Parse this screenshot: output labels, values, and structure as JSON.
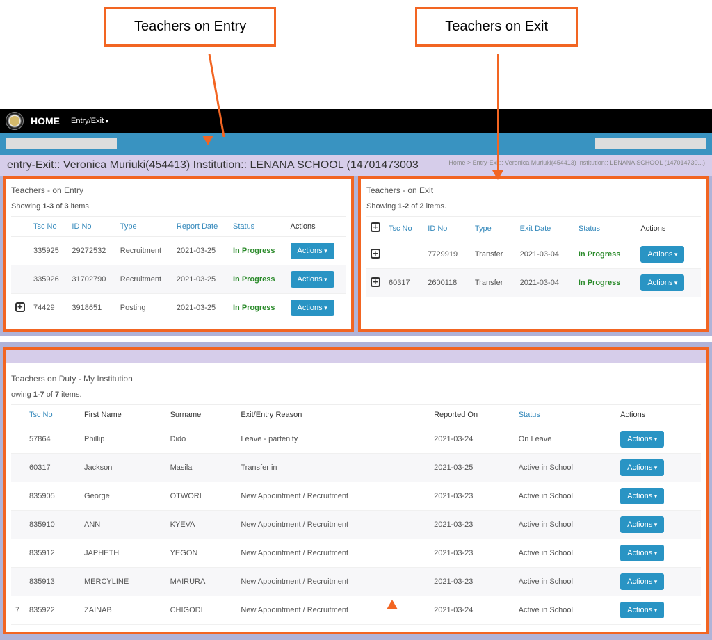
{
  "callouts": {
    "entry": "Teachers on Entry",
    "exit": "Teachers on Exit"
  },
  "topbar": {
    "home": "HOME",
    "menu1": "Entry/Exit"
  },
  "breadcrumb": {
    "left": "entry-Exit:: Veronica Muriuki(454413)  Institution:: LENANA SCHOOL (14701473003",
    "right": "Home >   Entry-Exit:: Veronica Muriuki(454413) Institution:: LENANA SCHOOL (147014730...)"
  },
  "entry_panel": {
    "title": "Teachers - on Entry",
    "showing_pre": "Showing ",
    "showing_bold": "1-3",
    "showing_mid": " of ",
    "showing_total": "3",
    "showing_post": " items.",
    "headers": {
      "tsc": "Tsc No",
      "id": "ID No",
      "type": "Type",
      "date": "Report Date",
      "status": "Status",
      "actions": "Actions"
    },
    "rows": [
      {
        "tsc": "335925",
        "id": "29272532",
        "type": "Recruitment",
        "date": "2021-03-25",
        "status": "In Progress"
      },
      {
        "tsc": "335926",
        "id": "31702790",
        "type": "Recruitment",
        "date": "2021-03-25",
        "status": "In Progress"
      },
      {
        "tsc": "74429",
        "id": "3918651",
        "type": "Posting",
        "date": "2021-03-25",
        "status": "In Progress"
      }
    ]
  },
  "exit_panel": {
    "title": "Teachers - on Exit",
    "showing_pre": "Showing ",
    "showing_bold": "1-2",
    "showing_mid": " of ",
    "showing_total": "2",
    "showing_post": " items.",
    "headers": {
      "tsc": "Tsc No",
      "id": "ID No",
      "type": "Type",
      "date": "Exit Date",
      "status": "Status",
      "actions": "Actions"
    },
    "rows": [
      {
        "tsc": "",
        "id": "7729919",
        "type": "Transfer",
        "date": "2021-03-04",
        "status": "In Progress"
      },
      {
        "tsc": "60317",
        "id": "2600118",
        "type": "Transfer",
        "date": "2021-03-04",
        "status": "In Progress"
      }
    ]
  },
  "duty_panel": {
    "title": "Teachers on Duty - My Institution",
    "showing_pre": "owing ",
    "showing_bold": "1-7",
    "showing_mid": " of ",
    "showing_total": "7",
    "showing_post": " items.",
    "headers": {
      "tsc": "Tsc No",
      "first": "First Name",
      "surname": "Surname",
      "reason": "Exit/Entry Reason",
      "reported": "Reported On",
      "status": "Status",
      "actions": "Actions"
    },
    "rows": [
      {
        "pre": "",
        "tsc": "57864",
        "first": "Phillip",
        "surname": "Dido",
        "reason": "Leave - partenity",
        "reported": "2021-03-24",
        "status": "On Leave"
      },
      {
        "pre": "",
        "tsc": "60317",
        "first": "Jackson",
        "surname": "Masila",
        "reason": "Transfer in",
        "reported": "2021-03-25",
        "status": "Active in School"
      },
      {
        "pre": "",
        "tsc": "835905",
        "first": "George",
        "surname": "OTWORI",
        "reason": "New Appointment / Recruitment",
        "reported": "2021-03-23",
        "status": "Active in School"
      },
      {
        "pre": "",
        "tsc": "835910",
        "first": "ANN",
        "surname": "KYEVA",
        "reason": "New Appointment / Recruitment",
        "reported": "2021-03-23",
        "status": "Active in School"
      },
      {
        "pre": "",
        "tsc": "835912",
        "first": "JAPHETH",
        "surname": "YEGON",
        "reason": "New Appointment / Recruitment",
        "reported": "2021-03-23",
        "status": "Active in School"
      },
      {
        "pre": "",
        "tsc": "835913",
        "first": "MERCYLINE",
        "surname": "MAIRURA",
        "reason": "New Appointment / Recruitment",
        "reported": "2021-03-23",
        "status": "Active in School"
      },
      {
        "pre": "7",
        "tsc": "835922",
        "first": "ZAINAB",
        "surname": "CHIGODI",
        "reason": "New Appointment / Recruitment",
        "reported": "2021-03-24",
        "status": "Active in School"
      }
    ]
  },
  "labels": {
    "actions_btn": "Actions"
  }
}
